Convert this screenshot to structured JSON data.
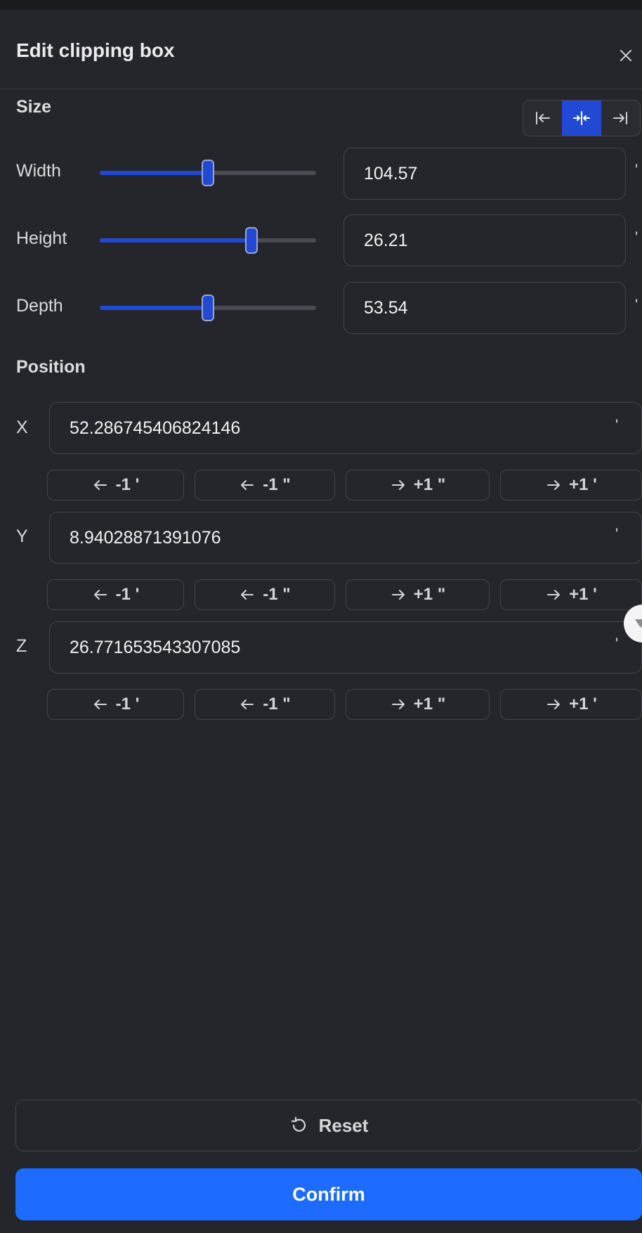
{
  "dialog": {
    "title": "Edit clipping box"
  },
  "size": {
    "label": "Size",
    "rows": [
      {
        "label": "Width",
        "value": "104.57",
        "unit": "'",
        "slider_fraction": 0.5
      },
      {
        "label": "Height",
        "value": "26.21",
        "unit": "'",
        "slider_fraction": 0.7
      },
      {
        "label": "Depth",
        "value": "53.54",
        "unit": "'",
        "slider_fraction": 0.5
      }
    ],
    "anchor_modes": [
      "align-start-icon",
      "align-center-icon",
      "align-end-icon"
    ],
    "anchor_active": "align-center-icon"
  },
  "position": {
    "label": "Position",
    "axes": [
      {
        "label": "X",
        "value": "52.286745406824146",
        "unit": "'"
      },
      {
        "label": "Y",
        "value": "8.94028871391076",
        "unit": "'"
      },
      {
        "label": "Z",
        "value": "26.771653543307085",
        "unit": "'"
      }
    ],
    "steps": [
      {
        "label": "-1 '",
        "icon": "arrow-left-icon"
      },
      {
        "label": "-1 \"",
        "icon": "arrow-left-icon"
      },
      {
        "label": "+1 \"",
        "icon": "arrow-right-icon"
      },
      {
        "label": "+1 '",
        "icon": "arrow-right-icon"
      }
    ]
  },
  "actions": {
    "reset_label": "Reset",
    "confirm_label": "Confirm"
  },
  "colors": {
    "accent": "#2249d4",
    "primary_button": "#1e6cff",
    "background": "#25262b"
  }
}
